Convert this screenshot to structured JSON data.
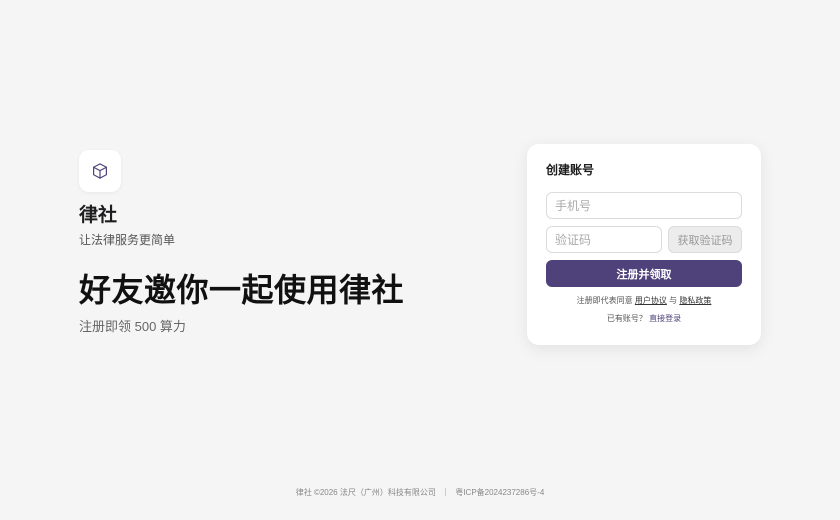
{
  "brand": {
    "name": "律社",
    "tagline": "让法律服务更简单",
    "logo_icon": "cube-icon",
    "accent_color": "#4f427a"
  },
  "hero": {
    "headline": "好友邀你一起使用律社",
    "subline": "注册即领 500 算力"
  },
  "signup_card": {
    "title": "创建账号",
    "phone_placeholder": "手机号",
    "code_placeholder": "验证码",
    "get_code_label": "获取验证码",
    "submit_label": "注册并领取",
    "agreement_prefix": "注册即代表同意",
    "user_agreement_label": "用户协议",
    "agreement_conjunction": "与",
    "privacy_policy_label": "隐私政策",
    "have_account_text": "已有账号？",
    "login_link_label": "直接登录"
  },
  "footer": {
    "copyright": "律社 ©2026 法尺（广州）科技有限公司",
    "icp": "粤ICP备2024237286号-4"
  }
}
